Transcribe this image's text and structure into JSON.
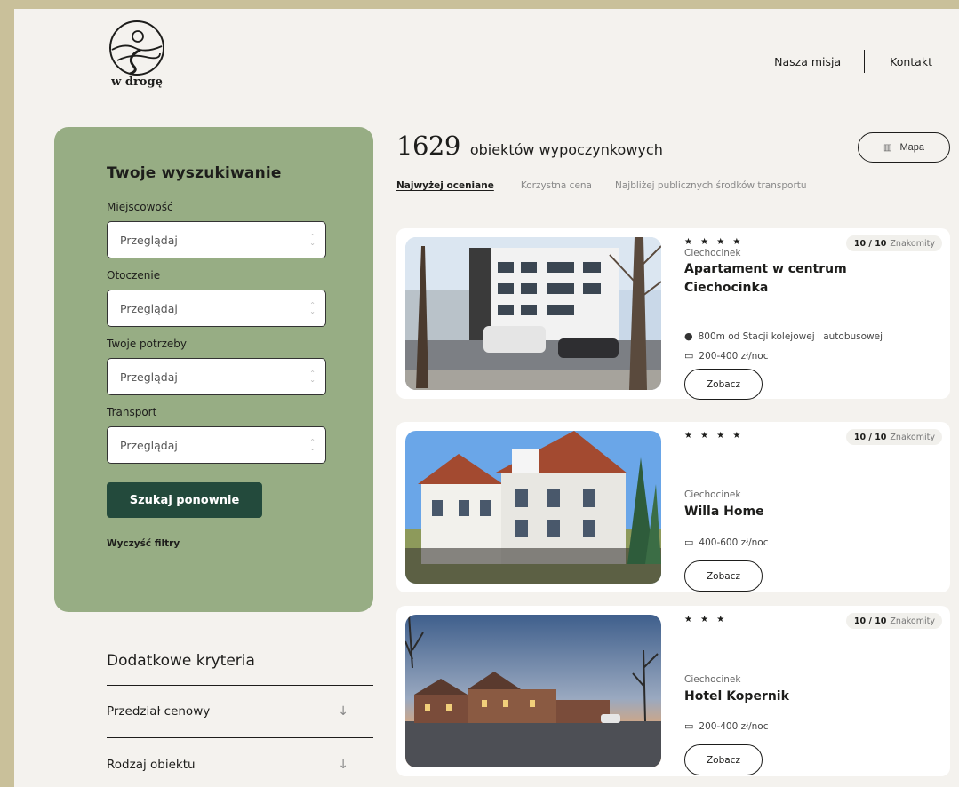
{
  "brand": {
    "logo_text": "w drogę"
  },
  "topnav": {
    "mission": "Nasza misja",
    "contact": "Kontakt"
  },
  "search": {
    "title": "Twoje wyszukiwanie",
    "fields": [
      {
        "label": "Miejscowość",
        "placeholder": "Przeglądaj"
      },
      {
        "label": "Otoczenie",
        "placeholder": "Przeglądaj"
      },
      {
        "label": "Twoje potrzeby",
        "placeholder": "Przeglądaj"
      },
      {
        "label": "Transport",
        "placeholder": "Przeglądaj"
      }
    ],
    "submit_label": "Szukaj ponownie",
    "clear_label": "Wyczyść filtry"
  },
  "extra": {
    "title": "Dodatkowe kryteria",
    "items": [
      "Przedział cenowy",
      "Rodzaj obiektu"
    ],
    "arrow": "↓"
  },
  "results": {
    "count": "1629",
    "count_label": "obiektów wypoczynkowych",
    "map_label": "Mapa",
    "sort_tabs": [
      "Najwyżej oceniane",
      "Korzystna cena",
      "Najbliżej publicznych środków transportu"
    ]
  },
  "listings": [
    {
      "stars": "★ ★ ★ ★",
      "rating_score": "10 / 10",
      "rating_label": "Znakomity",
      "city": "Ciechocinek",
      "name": "Apartament w centrum Ciechocinka",
      "distance": "800m od Stacji kolejowej i autobusowej",
      "price": "200-400 zł/noc",
      "cta": "Zobacz"
    },
    {
      "stars": "★ ★ ★ ★",
      "rating_score": "10 / 10",
      "rating_label": "Znakomity",
      "city": "Ciechocinek",
      "name": "Willa Home",
      "price": "400-600 zł/noc",
      "cta": "Zobacz"
    },
    {
      "stars": "★ ★ ★",
      "rating_score": "10 / 10",
      "rating_label": "Znakomity",
      "city": "Ciechocinek",
      "name": "Hotel Kopernik",
      "price": "200-400 zł/noc",
      "cta": "Zobacz"
    }
  ],
  "icons": {
    "select_arrows_up": "⌃",
    "select_arrows_down": "⌄",
    "pin": "●",
    "wallet": "▭",
    "map": "▥"
  }
}
